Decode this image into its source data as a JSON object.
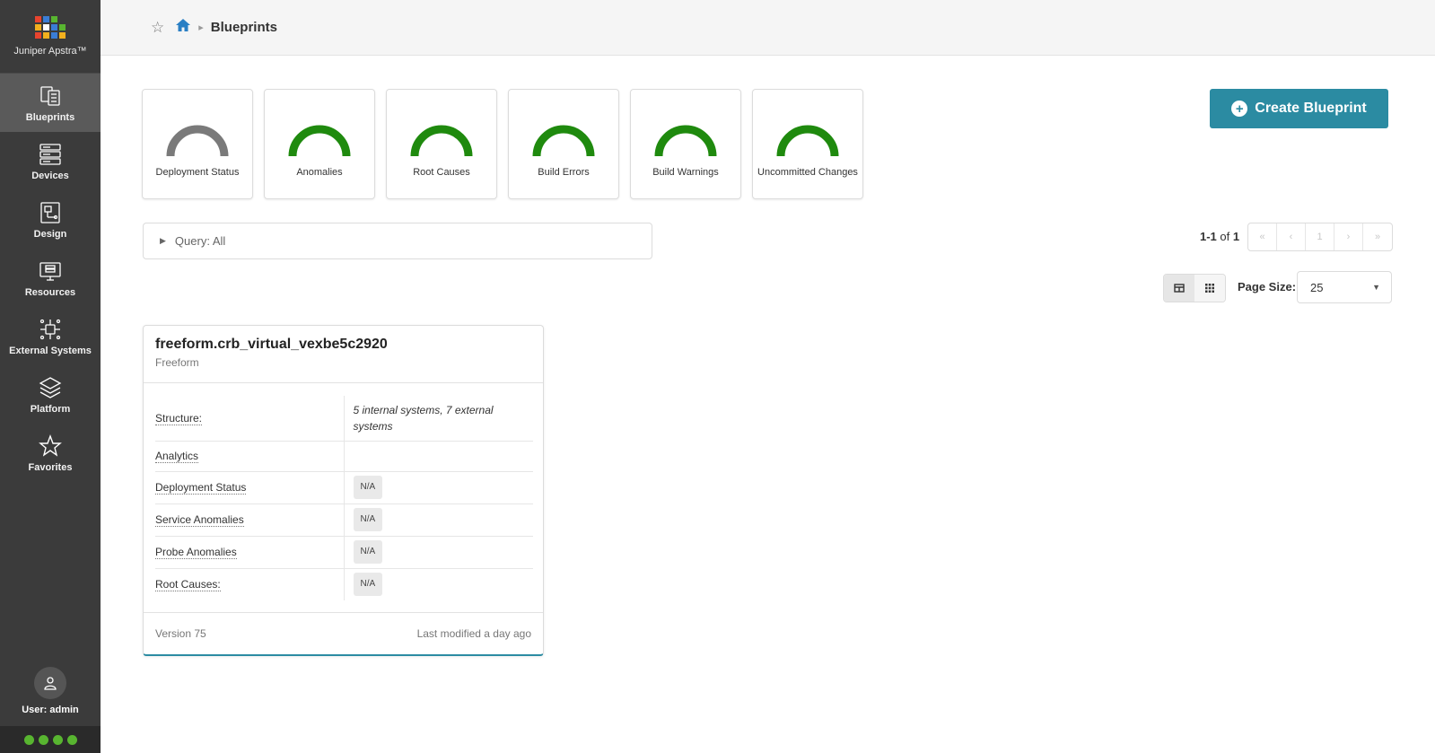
{
  "sidebar": {
    "logo_text": "Juniper Apstra™",
    "logo_colors": [
      "#3a7dd6",
      "#58b530",
      "#e8442e",
      "#f2b01e"
    ],
    "items": [
      {
        "label": "Blueprints",
        "icon": "blueprints-icon",
        "active": true
      },
      {
        "label": "Devices",
        "icon": "devices-icon"
      },
      {
        "label": "Design",
        "icon": "design-icon"
      },
      {
        "label": "Resources",
        "icon": "resources-icon"
      },
      {
        "label": "External Systems",
        "icon": "external-systems-icon"
      },
      {
        "label": "Platform",
        "icon": "platform-icon"
      },
      {
        "label": "Favorites",
        "icon": "star-icon"
      }
    ],
    "user_label": "User: admin",
    "status_color": "#58b530"
  },
  "breadcrumb": {
    "title": "Blueprints"
  },
  "gauges": [
    {
      "label": "Deployment Status",
      "color": "#7a7a7a"
    },
    {
      "label": "Anomalies",
      "color": "#1f8a0e"
    },
    {
      "label": "Root Causes",
      "color": "#1f8a0e"
    },
    {
      "label": "Build Errors",
      "color": "#1f8a0e"
    },
    {
      "label": "Build Warnings",
      "color": "#1f8a0e"
    },
    {
      "label": "Uncommitted Changes",
      "color": "#1f8a0e"
    }
  ],
  "create_button": {
    "label": "Create Blueprint",
    "color": "#2b8ba2"
  },
  "query": {
    "label": "Query: All"
  },
  "pagination": {
    "count_range": "1-1",
    "count_of": " of ",
    "count_total": "1",
    "controls": [
      "«",
      "‹",
      "1",
      "›",
      "»"
    ]
  },
  "page_size": {
    "label": "Page Size:",
    "value": "25"
  },
  "blueprint": {
    "name": "freeform.crb_virtual_vexbe5c2920",
    "type": "Freeform",
    "rows": [
      {
        "key": "Structure:",
        "value": "5 internal systems, 7 external systems",
        "badge": false
      },
      {
        "key": "Analytics",
        "value": "",
        "badge": false
      },
      {
        "key": "Deployment Status",
        "value": "N/A",
        "badge": true
      },
      {
        "key": "Service Anomalies",
        "value": "N/A",
        "badge": true
      },
      {
        "key": "Probe Anomalies",
        "value": "N/A",
        "badge": true
      },
      {
        "key": "Root Causes:",
        "value": "N/A",
        "badge": true
      }
    ],
    "version": "Version 75",
    "modified": "Last modified a day ago"
  }
}
